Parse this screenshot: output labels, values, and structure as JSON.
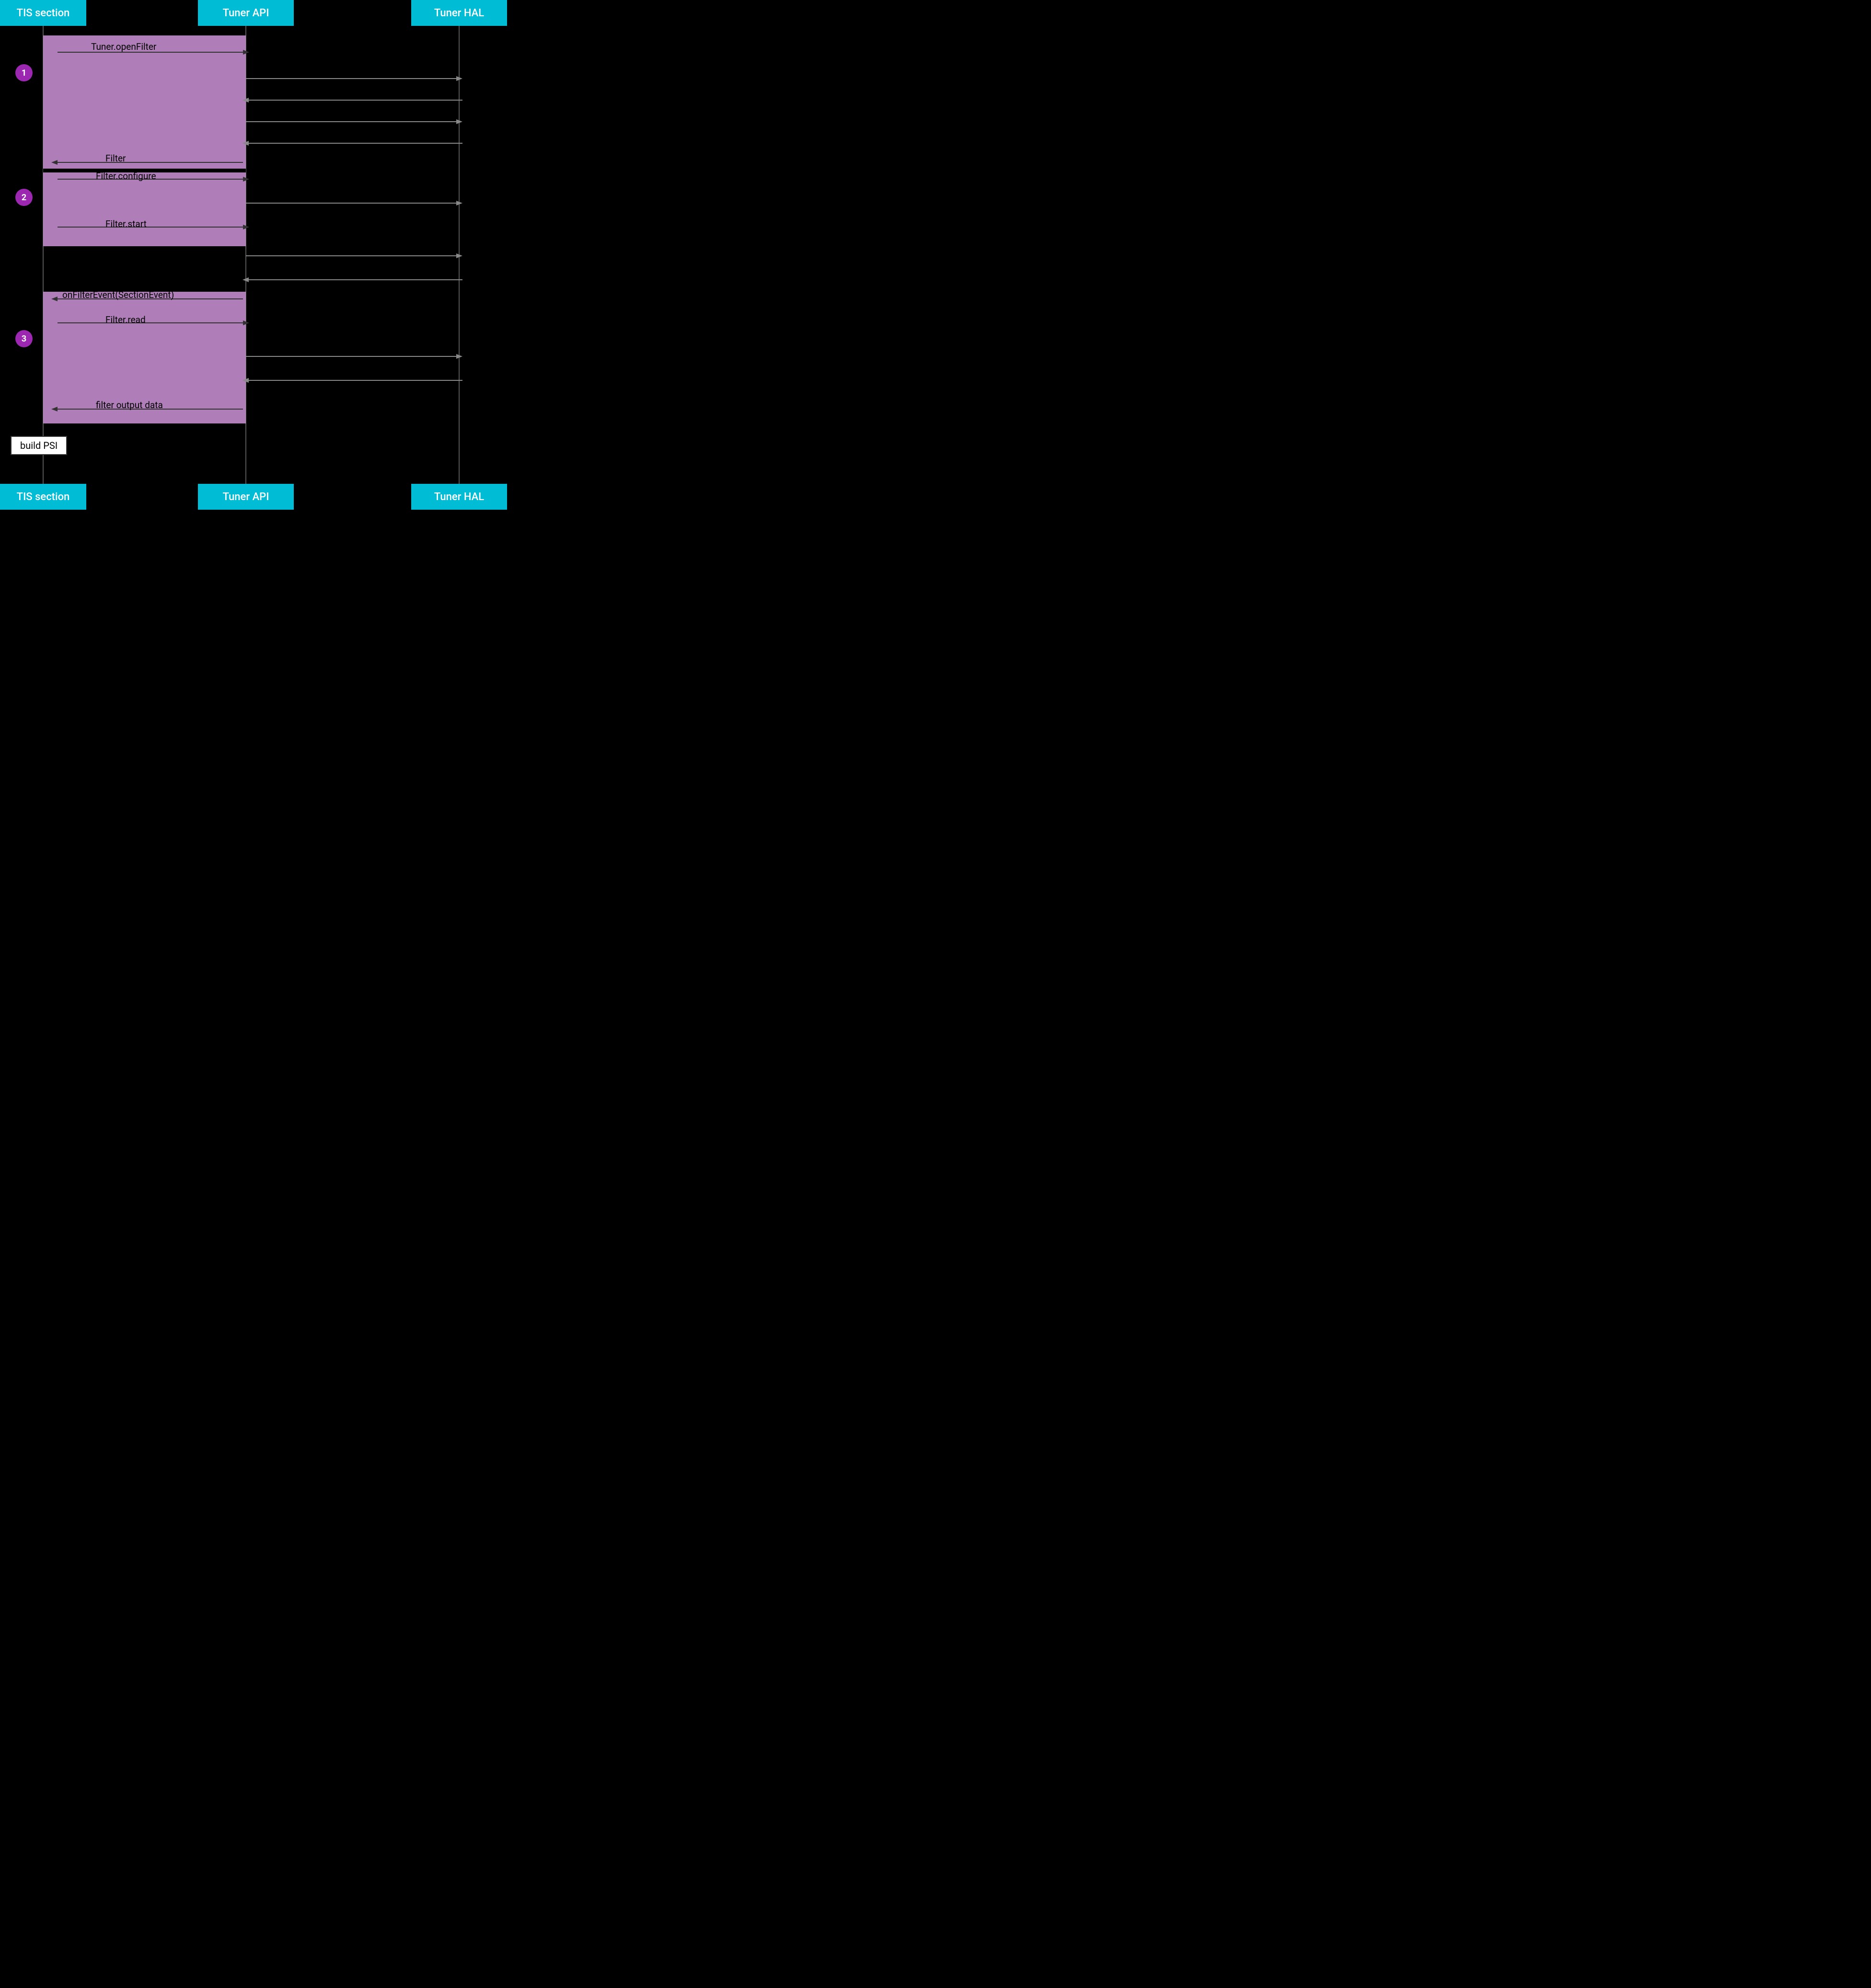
{
  "header": {
    "tis_label": "TIS section",
    "tuner_api_label": "Tuner API",
    "tuner_hal_label": "Tuner HAL"
  },
  "footer": {
    "tis_label": "TIS section",
    "tuner_api_label": "Tuner API",
    "tuner_hal_label": "Tuner HAL"
  },
  "steps": [
    {
      "number": "1"
    },
    {
      "number": "2"
    },
    {
      "number": "3"
    }
  ],
  "arrows": [
    {
      "label": "Tuner.openFilter",
      "id": "a1"
    },
    {
      "label": "Filter",
      "id": "a2"
    },
    {
      "label": "Filter.configure",
      "id": "a3"
    },
    {
      "label": "Filter.start",
      "id": "a4"
    },
    {
      "label": "onFilterEvent(SectionEvent)",
      "id": "a5"
    },
    {
      "label": "Filter.read",
      "id": "a6"
    },
    {
      "label": "filter output data",
      "id": "a7"
    }
  ],
  "build_psi_label": "build PSI",
  "colors": {
    "header_bg": "#00BCD4",
    "block_bg": "#CE93D8",
    "step_bg": "#9C27B0",
    "bg": "#000000",
    "white": "#ffffff"
  }
}
